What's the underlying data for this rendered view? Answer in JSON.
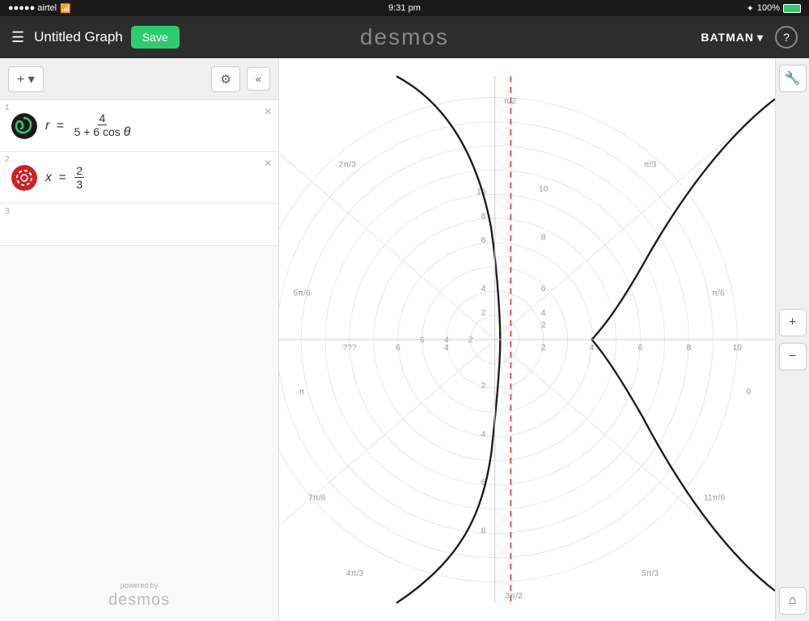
{
  "statusBar": {
    "carrier": "●●●●● airtel",
    "wifi": "WiFi",
    "time": "9:31 pm",
    "bluetooth": "BT",
    "battery": "100%"
  },
  "topNav": {
    "graphTitle": "Untitled Graph",
    "saveLabel": "Save",
    "logoText": "desmos",
    "username": "BATMAN",
    "helpLabel": "?"
  },
  "toolbar": {
    "addLabel": "+ ▾",
    "settingsLabel": "⚙",
    "collapseLabel": "«"
  },
  "expressions": [
    {
      "id": 1,
      "iconColor1": "#1a6b1a",
      "iconColor2": "#2ecc71",
      "formulaType": "polar",
      "display": "r = 4 / (5 + 6 cos θ)"
    },
    {
      "id": 2,
      "iconColor1": "#cc2222",
      "iconColor2": "#e74c3c",
      "formulaType": "vertical",
      "display": "x = 2/3"
    },
    {
      "id": 3,
      "empty": true
    }
  ],
  "branding": {
    "poweredBy": "powered by",
    "logoText": "desmos"
  },
  "graph": {
    "polarAngles": [
      "π/2",
      "2π/3",
      "π/3",
      "5π/6",
      "π/6",
      "π",
      "0",
      "7π/6",
      "11π/6",
      "4π/3",
      "3π/2",
      "5π/3"
    ],
    "radialLabels": [
      2,
      4,
      6,
      8,
      10
    ],
    "axisLabels": {
      "xPositive": [
        2,
        4,
        6,
        8,
        10
      ],
      "xNegative": [
        2,
        4,
        6
      ],
      "yPositive": [
        2,
        4,
        6,
        8,
        10
      ],
      "yNegative": [
        2,
        4,
        6,
        8
      ]
    }
  },
  "rightTools": {
    "wrenchLabel": "🔧",
    "zoomInLabel": "+",
    "zoomOutLabel": "−",
    "homeLabel": "⌂"
  }
}
